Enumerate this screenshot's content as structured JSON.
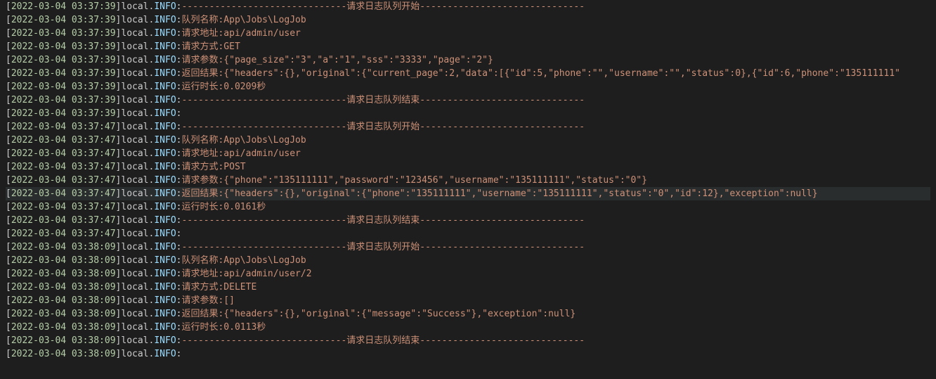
{
  "channel": "local",
  "level": "INFO",
  "lines": [
    {
      "ts": "2022-03-04 03:37:39",
      "msg": "------------------------------请求日志队列开始------------------------------"
    },
    {
      "ts": "2022-03-04 03:37:39",
      "msg": "队列名称:App\\Jobs\\LogJob"
    },
    {
      "ts": "2022-03-04 03:37:39",
      "msg": "请求地址:api/admin/user"
    },
    {
      "ts": "2022-03-04 03:37:39",
      "msg": "请求方式:GET"
    },
    {
      "ts": "2022-03-04 03:37:39",
      "msg": "请求参数:{\"page_size\":\"3\",\"a\":\"1\",\"sss\":\"3333\",\"page\":\"2\"}"
    },
    {
      "ts": "2022-03-04 03:37:39",
      "msg": "返回结果:{\"headers\":{},\"original\":{\"current_page\":2,\"data\":[{\"id\":5,\"phone\":\"\",\"username\":\"\",\"status\":0},{\"id\":6,\"phone\":\"135111111\""
    },
    {
      "ts": "2022-03-04 03:37:39",
      "msg": "运行时长:0.0209秒"
    },
    {
      "ts": "2022-03-04 03:37:39",
      "msg": "------------------------------请求日志队列结束------------------------------"
    },
    {
      "ts": "2022-03-04 03:37:39",
      "msg": ""
    },
    {
      "ts": "2022-03-04 03:37:47",
      "msg": "------------------------------请求日志队列开始------------------------------"
    },
    {
      "ts": "2022-03-04 03:37:47",
      "msg": "队列名称:App\\Jobs\\LogJob"
    },
    {
      "ts": "2022-03-04 03:37:47",
      "msg": "请求地址:api/admin/user"
    },
    {
      "ts": "2022-03-04 03:37:47",
      "msg": "请求方式:POST"
    },
    {
      "ts": "2022-03-04 03:37:47",
      "msg": "请求参数:{\"phone\":\"135111111\",\"password\":\"123456\",\"username\":\"135111111\",\"status\":\"0\"}"
    },
    {
      "ts": "2022-03-04 03:37:47",
      "msg": "返回结果:{\"headers\":{},\"original\":{\"phone\":\"135111111\",\"username\":\"135111111\",\"status\":\"0\",\"id\":12},\"exception\":null}",
      "highlight": true
    },
    {
      "ts": "2022-03-04 03:37:47",
      "msg": "运行时长:0.0161秒"
    },
    {
      "ts": "2022-03-04 03:37:47",
      "msg": "------------------------------请求日志队列结束------------------------------"
    },
    {
      "ts": "2022-03-04 03:37:47",
      "msg": ""
    },
    {
      "ts": "2022-03-04 03:38:09",
      "msg": "------------------------------请求日志队列开始------------------------------"
    },
    {
      "ts": "2022-03-04 03:38:09",
      "msg": "队列名称:App\\Jobs\\LogJob"
    },
    {
      "ts": "2022-03-04 03:38:09",
      "msg": "请求地址:api/admin/user/2"
    },
    {
      "ts": "2022-03-04 03:38:09",
      "msg": "请求方式:DELETE"
    },
    {
      "ts": "2022-03-04 03:38:09",
      "msg": "请求参数:[]"
    },
    {
      "ts": "2022-03-04 03:38:09",
      "msg": "返回结果:{\"headers\":{},\"original\":{\"message\":\"Success\"},\"exception\":null}"
    },
    {
      "ts": "2022-03-04 03:38:09",
      "msg": "运行时长:0.0113秒"
    },
    {
      "ts": "2022-03-04 03:38:09",
      "msg": "------------------------------请求日志队列结束------------------------------"
    },
    {
      "ts": "2022-03-04 03:38:09",
      "msg": ""
    }
  ]
}
